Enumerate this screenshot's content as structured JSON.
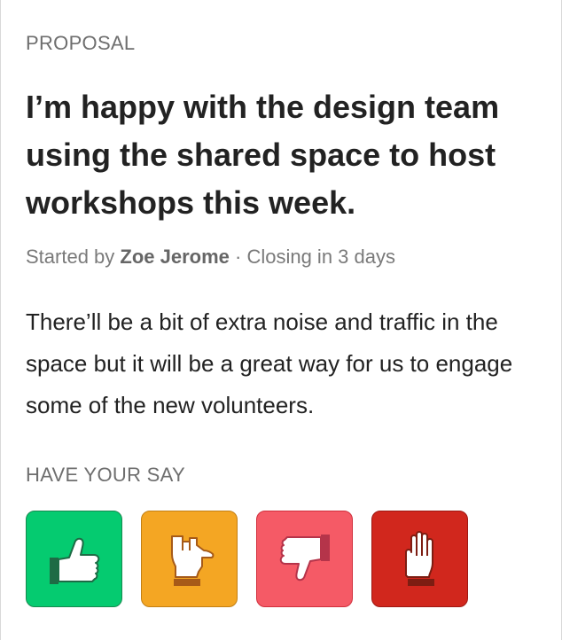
{
  "proposal": {
    "kicker": "PROPOSAL",
    "title": "I’m happy with the design team using the shared space to host workshops this week.",
    "meta": {
      "started_prefix": "Started by ",
      "author": "Zoe Jerome",
      "separator": " · ",
      "closing": "Closing in 3 days"
    },
    "description": "There’ll be a bit of extra noise and traffic in the space but it will be a great way for us to engage some of the new volunteers."
  },
  "vote": {
    "label": "HAVE YOUR SAY",
    "options": [
      {
        "name": "agree",
        "icon": "thumbs-up-icon",
        "color": "#05cb70"
      },
      {
        "name": "abstain",
        "icon": "thumb-sideways-icon",
        "color": "#f4a623"
      },
      {
        "name": "disagree",
        "icon": "thumbs-down-icon",
        "color": "#f55a66"
      },
      {
        "name": "block",
        "icon": "raised-hand-icon",
        "color": "#d1271d"
      }
    ]
  }
}
